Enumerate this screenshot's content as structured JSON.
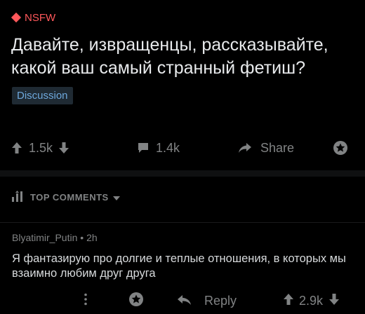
{
  "post": {
    "nsfw_label": "NSFW",
    "title": "Давайте, извращенцы, рассказывайте, какой ваш самый странный фетиш?",
    "flair": "Discussion",
    "upvotes": "1.5k",
    "comments": "1.4k",
    "share_label": "Share"
  },
  "sort": {
    "label": "TOP COMMENTS"
  },
  "comment": {
    "author": "Blyatimir_Putin",
    "separator": "•",
    "age": "2h",
    "body": "Я фантазирую про долгие и теплые отношения, в которых мы взаимно любим друг друга",
    "reply_label": "Reply",
    "votes": "2.9k"
  },
  "colors": {
    "background": "#000000",
    "nsfw": "#ff585b",
    "flair_text": "#6ea8dc",
    "muted": "#818384",
    "text": "#d7dadc"
  },
  "icons": [
    "nsfw-diamond-icon",
    "upvote-arrow-icon",
    "downvote-arrow-icon",
    "comment-bubble-icon",
    "share-arrow-icon",
    "save-star-icon",
    "sort-bars-icon",
    "chevron-down-icon",
    "more-dots-icon",
    "reply-arrow-icon"
  ]
}
